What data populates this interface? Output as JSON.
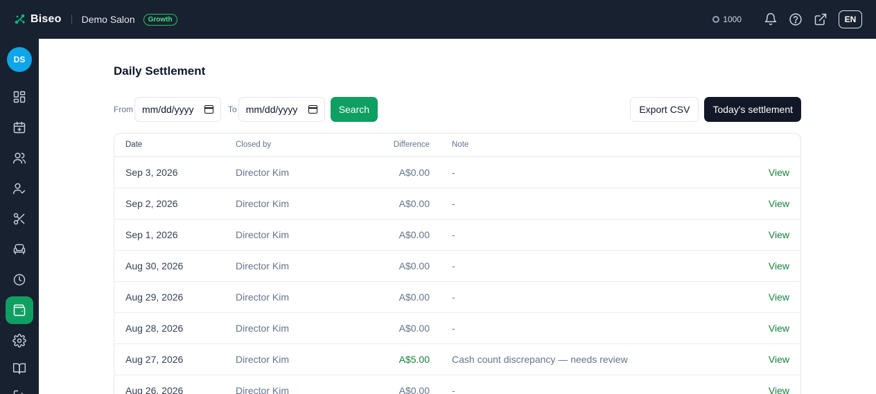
{
  "app": {
    "brand": "Biseo",
    "salon": "Demo Salon",
    "plan": "Growth",
    "credits": "1000",
    "language": "EN",
    "avatar_initials": "DS"
  },
  "page": {
    "title": "Daily Settlement",
    "from_label": "From",
    "to_label": "To",
    "from_placeholder": "mm/dd/yyyy",
    "to_placeholder": "mm/dd/yyyy",
    "search_label": "Search",
    "export_label": "Export CSV",
    "today_label": "Today's settlement"
  },
  "table": {
    "headers": {
      "date": "Date",
      "closed_by": "Closed by",
      "difference": "Difference",
      "note": "Note"
    },
    "rows": [
      {
        "date": "Sep 3, 2026",
        "closed_by": "Director Kim",
        "difference": "A$0.00",
        "note": "-",
        "action": "View"
      },
      {
        "date": "Sep 2, 2026",
        "closed_by": "Director Kim",
        "difference": "A$0.00",
        "note": "-",
        "action": "View"
      },
      {
        "date": "Sep 1, 2026",
        "closed_by": "Director Kim",
        "difference": "A$0.00",
        "note": "-",
        "action": "View"
      },
      {
        "date": "Aug 30, 2026",
        "closed_by": "Director Kim",
        "difference": "A$0.00",
        "note": "-",
        "action": "View"
      },
      {
        "date": "Aug 29, 2026",
        "closed_by": "Director Kim",
        "difference": "A$0.00",
        "note": "-",
        "action": "View"
      },
      {
        "date": "Aug 28, 2026",
        "closed_by": "Director Kim",
        "difference": "A$0.00",
        "note": "-",
        "action": "View"
      },
      {
        "date": "Aug 27, 2026",
        "closed_by": "Director Kim",
        "difference": "A$5.00",
        "note": "Cash count discrepancy — needs review",
        "action": "View"
      },
      {
        "date": "Aug 26, 2026",
        "closed_by": "Director Kim",
        "difference": "A$0.00",
        "note": "-",
        "action": "View"
      }
    ]
  },
  "colors": {
    "topbar": "#182130",
    "accent": "#0f9f63",
    "dark_button": "#111827",
    "avatar": "#0ea5e9"
  },
  "sidebar_icons": [
    "dashboard-icon",
    "calendar-plus-icon",
    "users-icon",
    "user-check-icon",
    "scissors-icon",
    "sofa-icon",
    "clock-icon",
    "wallet-icon",
    "settings-icon",
    "book-icon",
    "logout-icon"
  ]
}
